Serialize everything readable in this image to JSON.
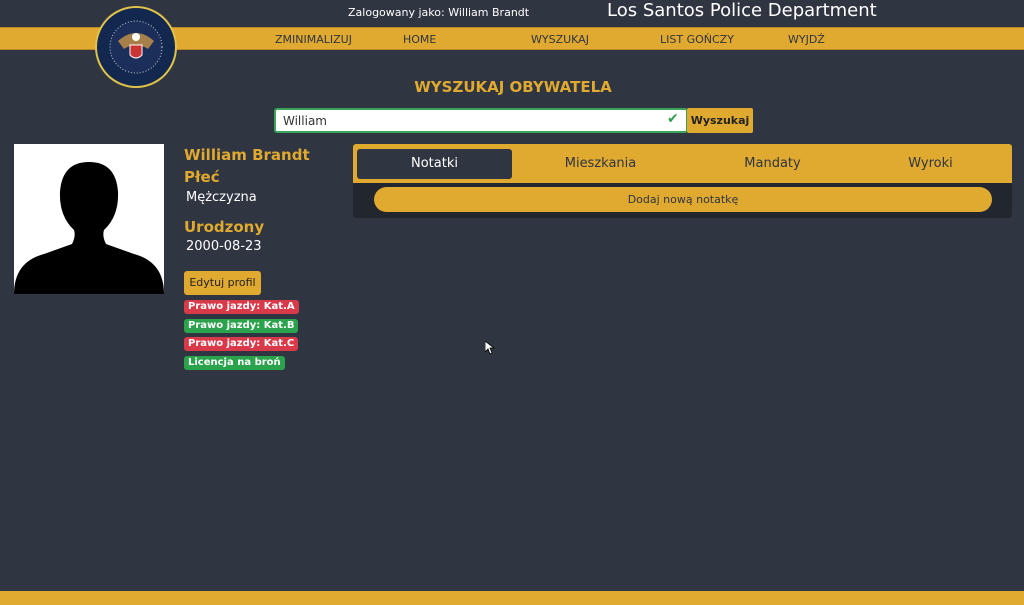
{
  "header": {
    "logged_in": "Zalogowany jako: William Brandt",
    "brand": "Los Santos Police Department",
    "logo_text": "LOS SANTOS POLICE DEPARTMENT"
  },
  "nav": [
    "ZMINIMALIZUJ",
    "HOME",
    "WYSZUKAJ",
    "LIST GOŃCZY",
    "WYJDŹ"
  ],
  "search": {
    "title": "WYSZUKAJ OBYWATELA",
    "value": "William",
    "button": "Wyszukaj"
  },
  "profile": {
    "name": "William Brandt",
    "gender_label": "Płeć",
    "gender": "Mężczyzna",
    "born_label": "Urodzony",
    "born": "2000-08-23",
    "edit": "Edytuj profil",
    "badges": [
      {
        "text": "Prawo jazdy: Kat.A",
        "status": "red"
      },
      {
        "text": "Prawo jazdy: Kat.B",
        "status": "green"
      },
      {
        "text": "Prawo jazdy: Kat.C",
        "status": "red"
      },
      {
        "text": "Licencja na broń",
        "status": "green"
      }
    ]
  },
  "tabs": [
    "Notatki",
    "Mieszkania",
    "Mandaty",
    "Wyroki"
  ],
  "notes": {
    "add": "Dodaj nową notatkę"
  },
  "colors": {
    "accent": "#e0a92f",
    "bg": "#2f3541",
    "red": "#d93a4a",
    "green": "#2ba24c"
  }
}
